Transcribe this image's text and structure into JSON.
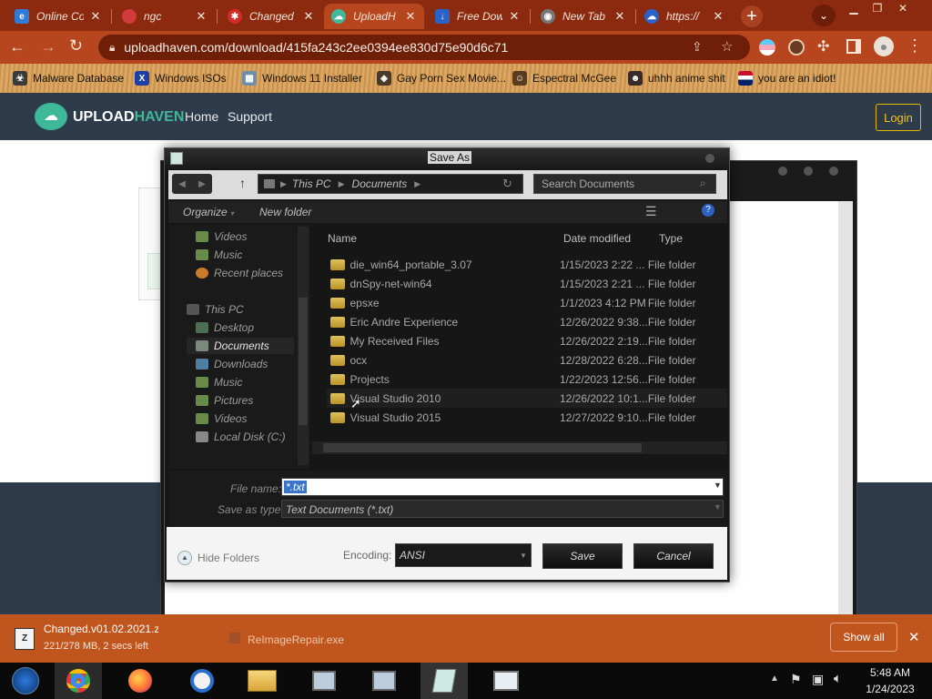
{
  "browser": {
    "tabs": [
      {
        "label": "Online Co",
        "icon": "edge-icon",
        "color": "#2f7bd6"
      },
      {
        "label": "ngc",
        "icon": "cloud-icon",
        "color": "#d13b3b"
      },
      {
        "label": "Changed",
        "icon": "gear-icon",
        "color": "#d42a2a"
      },
      {
        "label": "UploadH",
        "icon": "uploadhaven-icon",
        "color": "#3fb89a"
      },
      {
        "label": "Free Dow",
        "icon": "download-icon",
        "color": "#2a62c9"
      },
      {
        "label": "New Tab",
        "icon": "chrome-icon",
        "color": "#666666"
      },
      {
        "label": "https://",
        "icon": "cloud-icon",
        "color": "#2a62c9"
      }
    ],
    "new_tab_glyph": "+",
    "url": "uploadhaven.com/download/415fa243c2ee0394ee830d75e90d6c71",
    "bookmarks": [
      {
        "label": "Malware Database",
        "icon": "malware-icon"
      },
      {
        "label": "Windows ISOs",
        "icon": "x-icon"
      },
      {
        "label": "Windows 11 Installer",
        "icon": "installer-icon"
      },
      {
        "label": "Gay Porn Sex Movie...",
        "icon": "bookmark-icon"
      },
      {
        "label": "Espectral McGee",
        "icon": "bookmark-icon"
      },
      {
        "label": "uhhh anime shit",
        "icon": "bookmark-icon"
      },
      {
        "label": "you are an idiot!",
        "icon": "flag-icon"
      }
    ]
  },
  "site": {
    "logo_upload": "UPLOAD",
    "logo_haven": "HAVEN",
    "nav": [
      "Home",
      "Support"
    ],
    "login": "Login",
    "accent": "#3fb89a"
  },
  "dialog": {
    "title": "Save As",
    "breadcrumb": [
      "This PC",
      "Documents"
    ],
    "search_placeholder": "Search Documents",
    "organize": "Organize",
    "new_folder": "New folder",
    "nav_items": [
      {
        "label": "Videos",
        "icon": "videos-icon"
      },
      {
        "label": "Music",
        "icon": "music-icon"
      },
      {
        "label": "Recent places",
        "icon": "recent-places-icon"
      },
      {
        "label": "This PC",
        "icon": "this-pc-icon"
      },
      {
        "label": "Desktop",
        "icon": "desktop-icon"
      },
      {
        "label": "Documents",
        "icon": "documents-icon"
      },
      {
        "label": "Downloads",
        "icon": "downloads-icon"
      },
      {
        "label": "Music",
        "icon": "music-icon"
      },
      {
        "label": "Pictures",
        "icon": "pictures-icon"
      },
      {
        "label": "Videos",
        "icon": "videos-icon"
      },
      {
        "label": "Local Disk (C:)",
        "icon": "disk-icon"
      }
    ],
    "columns": [
      "Name",
      "Date modified",
      "Type"
    ],
    "files": [
      {
        "name": "die_win64_portable_3.07",
        "date": "1/15/2023 2:22 ...",
        "type": "File folder"
      },
      {
        "name": "dnSpy-net-win64",
        "date": "1/15/2023 2:21 ...",
        "type": "File folder"
      },
      {
        "name": "epsxe",
        "date": "1/1/2023 4:12 PM",
        "type": "File folder"
      },
      {
        "name": "Eric Andre Experience",
        "date": "12/26/2022 9:38...",
        "type": "File folder"
      },
      {
        "name": "My Received Files",
        "date": "12/26/2022 2:19...",
        "type": "File folder"
      },
      {
        "name": "ocx",
        "date": "12/28/2022 6:28...",
        "type": "File folder"
      },
      {
        "name": "Projects",
        "date": "1/22/2023 12:56...",
        "type": "File folder"
      },
      {
        "name": "Visual Studio 2010",
        "date": "12/26/2022 10:1...",
        "type": "File folder"
      },
      {
        "name": "Visual Studio 2015",
        "date": "12/27/2022 9:10...",
        "type": "File folder"
      }
    ],
    "file_name_label": "File name:",
    "file_name_value": "*.txt",
    "save_type_label": "Save as type:",
    "save_type_value": "Text Documents (*.txt)",
    "hide_folders": "Hide Folders",
    "encoding_label": "Encoding:",
    "encoding_value": "ANSI",
    "save": "Save",
    "cancel": "Cancel"
  },
  "downloads": {
    "item1_name": "Changed.v01.02.2021.z",
    "item1_status": "221/278 MB, 2 secs left",
    "item2_name": "ReImageRepair.exe",
    "show_all": "Show all"
  },
  "taskbar": {
    "apps": [
      "windows-start-icon",
      "chrome-icon",
      "firefox-icon",
      "opera-icon",
      "file-explorer-icon",
      "computer-icon",
      "computer-icon",
      "notepad-icon",
      "window-icon"
    ],
    "time": "5:48 AM",
    "date": "1/24/2023"
  }
}
